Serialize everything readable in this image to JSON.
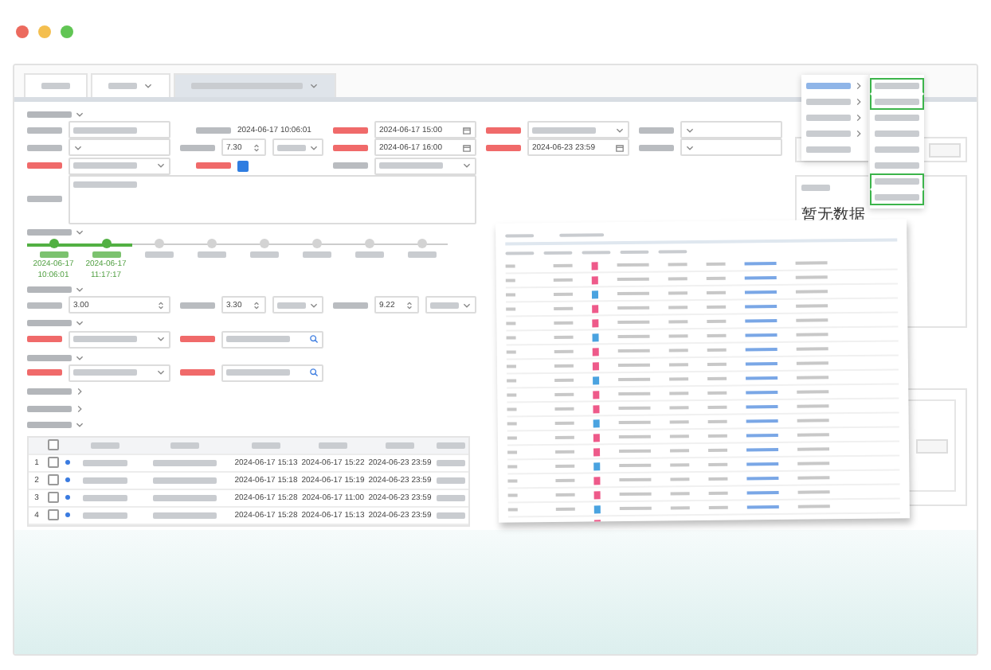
{
  "window": {
    "controls": [
      {
        "color": "#ec6a5e"
      },
      {
        "color": "#f4bf4f"
      },
      {
        "color": "#61c554"
      }
    ]
  },
  "tabs": [
    {
      "selected": false,
      "closable": false
    },
    {
      "selected": false,
      "closable": true
    },
    {
      "selected": true,
      "closable": true
    }
  ],
  "sections": [
    {
      "kind": "form",
      "expanded": true,
      "rows": [
        {
          "fields": [
            {
              "kind": "text",
              "required": false,
              "blurred": true
            },
            {
              "kind": "plain",
              "required": false,
              "value": "2024-06-17 10:06:01"
            },
            {
              "kind": "date",
              "required": true,
              "value": "2024-06-17 15:00"
            },
            {
              "kind": "select",
              "required": true,
              "blurred": true
            },
            {
              "kind": "select",
              "required": false
            }
          ]
        },
        {
          "fields": [
            {
              "kind": "select",
              "required": false
            },
            {
              "kind": "number",
              "required": false,
              "value": "7.30",
              "unit": true
            },
            {
              "kind": "date",
              "required": true,
              "value": "2024-06-17 16:00"
            },
            {
              "kind": "date",
              "required": true,
              "value": "2024-06-23 23:59"
            },
            {
              "kind": "select",
              "required": false
            }
          ]
        },
        {
          "fields": [
            {
              "kind": "select",
              "required": true,
              "blurred": true
            },
            {
              "kind": "check",
              "required": true,
              "checked": true
            },
            {
              "kind": "select",
              "required": false,
              "blurred": true
            }
          ]
        },
        {
          "fields": [
            {
              "kind": "textarea",
              "required": false,
              "blurred": true
            }
          ]
        }
      ]
    },
    {
      "kind": "steps",
      "expanded": true,
      "steps": [
        {
          "done": true,
          "date": "2024-06-17",
          "time": "10:06:01"
        },
        {
          "done": true,
          "date": "2024-06-17",
          "time": "11:17:17"
        },
        {
          "done": false
        },
        {
          "done": false
        },
        {
          "done": false
        },
        {
          "done": false
        },
        {
          "done": false
        },
        {
          "done": false
        }
      ]
    },
    {
      "kind": "form",
      "expanded": true,
      "rows": [
        {
          "fields": [
            {
              "kind": "number",
              "required": false,
              "value": "3.00"
            },
            {
              "kind": "number",
              "required": false,
              "value": "3.30",
              "unit": true
            },
            {
              "kind": "number",
              "required": false,
              "value": "9.22",
              "unit": true
            }
          ]
        }
      ]
    },
    {
      "kind": "form",
      "expanded": true,
      "rows": [
        {
          "fields": [
            {
              "kind": "select",
              "required": true,
              "blurred": true
            },
            {
              "kind": "search",
              "required": true,
              "blurred": true
            }
          ]
        }
      ]
    },
    {
      "kind": "form",
      "expanded": true,
      "rows": [
        {
          "fields": [
            {
              "kind": "select",
              "required": true,
              "blurred": true
            },
            {
              "kind": "search",
              "required": true,
              "blurred": true
            }
          ]
        }
      ]
    },
    {
      "kind": "form",
      "expanded": false
    },
    {
      "kind": "form",
      "expanded": false
    },
    {
      "kind": "table",
      "expanded": true,
      "table": {
        "header_checked": false,
        "rows": [
          {
            "index": "1",
            "checked": false,
            "dates": [
              "2024-06-17 15:13",
              "2024-06-17 15:22",
              "2024-06-23 23:59"
            ]
          },
          {
            "index": "2",
            "checked": false,
            "dates": [
              "2024-06-17 15:18",
              "2024-06-17 15:19",
              "2024-06-23 23:59"
            ]
          },
          {
            "index": "3",
            "checked": false,
            "dates": [
              "2024-06-17 15:28",
              "2024-06-17 11:00",
              "2024-06-23 23:59"
            ]
          },
          {
            "index": "4",
            "checked": false,
            "dates": [
              "2024-06-17 15:28",
              "2024-06-17 15:13",
              "2024-06-23 23:59"
            ]
          }
        ]
      }
    }
  ],
  "side_cards": [
    {
      "kind": "action"
    },
    {
      "kind": "empty",
      "message": "暂无数据"
    },
    {
      "kind": "list"
    }
  ],
  "menu": {
    "items": [
      {
        "has_submenu": true
      },
      {
        "has_submenu": true
      },
      {
        "has_submenu": true
      },
      {
        "has_submenu": true
      },
      {
        "has_submenu": false
      }
    ],
    "submenu": [
      {
        "highlighted": true
      },
      {
        "highlighted": true
      },
      {
        "highlighted": false
      },
      {
        "highlighted": false
      },
      {
        "highlighted": false
      },
      {
        "highlighted": false
      },
      {
        "highlighted": true
      },
      {
        "highlighted": true
      }
    ]
  }
}
